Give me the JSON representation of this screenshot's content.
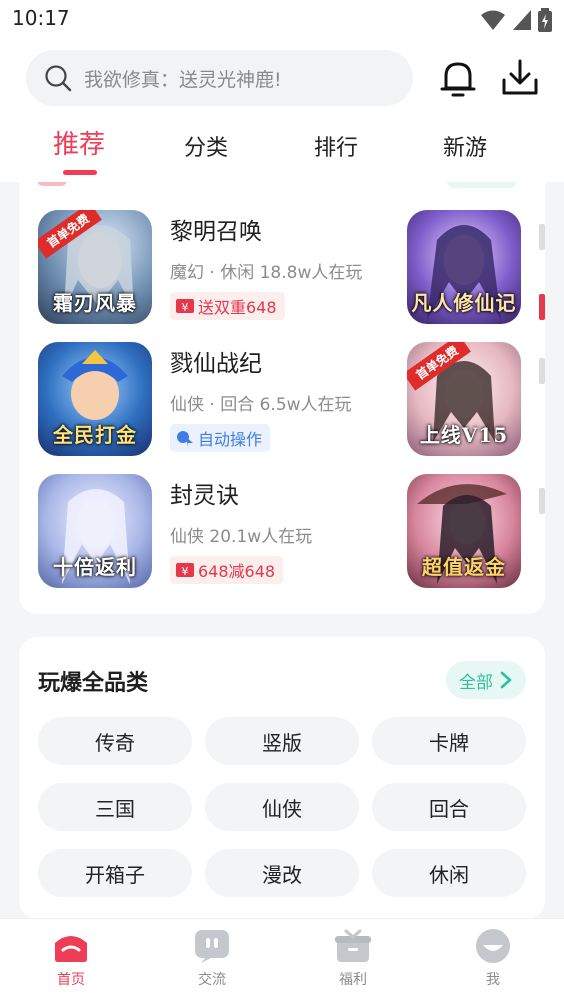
{
  "status_bar": {
    "time": "10:17"
  },
  "header": {
    "search_placeholder": "我欲修真：送灵光神鹿!",
    "icons": [
      "search-icon",
      "bell-icon",
      "download-icon"
    ]
  },
  "tabs": [
    {
      "label": "推荐",
      "active": true
    },
    {
      "label": "分类",
      "active": false
    },
    {
      "label": "排行",
      "active": false
    },
    {
      "label": "新游",
      "active": false
    }
  ],
  "games": [
    {
      "title": "黎明召唤",
      "meta": "魔幻 · 休闲  18.8w人在玩",
      "tag": "送双重648",
      "tag_type": "red",
      "art_text": "霜刃风暴",
      "badge": "首单免费"
    },
    {
      "title": "戮仙战纪",
      "meta": "仙侠 · 回合  6.5w人在玩",
      "tag": "自动操作",
      "tag_type": "blue",
      "art_text": "全民打金",
      "badge": ""
    },
    {
      "title": "封灵诀",
      "meta": "仙侠  20.1w人在玩",
      "tag": "648减648",
      "tag_type": "red",
      "art_text": "十倍返利",
      "badge": ""
    }
  ],
  "games_right": [
    {
      "art_text": "凡人修仙记",
      "badge": ""
    },
    {
      "art_text": "上线V15",
      "badge": "首单免费"
    },
    {
      "art_text": "超值返金",
      "badge": ""
    }
  ],
  "categories": {
    "title": "玩爆全品类",
    "all_label": "全部",
    "items": [
      "传奇",
      "竖版",
      "卡牌",
      "三国",
      "仙侠",
      "回合",
      "开箱子",
      "漫改",
      "休闲"
    ]
  },
  "bottom_nav": [
    {
      "label": "首页",
      "icon": "home-icon",
      "active": true
    },
    {
      "label": "交流",
      "icon": "chat-icon",
      "active": false
    },
    {
      "label": "福利",
      "icon": "gift-icon",
      "active": false
    },
    {
      "label": "我",
      "icon": "profile-icon",
      "active": false
    }
  ],
  "colors": {
    "accent": "#ef3d57",
    "teal": "#2fbfa0"
  }
}
